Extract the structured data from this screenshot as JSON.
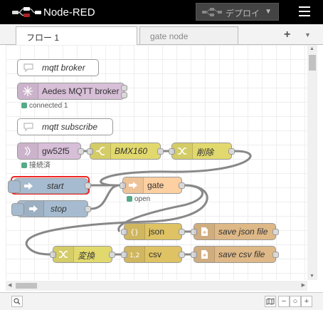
{
  "app": {
    "title": "Node-RED"
  },
  "header": {
    "deploy_label": "デプロイ"
  },
  "tabs": [
    {
      "label": "フロー 1",
      "active": true
    },
    {
      "label": "gate node",
      "active": false
    }
  ],
  "nodes": {
    "mqtt_broker": {
      "label": "mqtt broker"
    },
    "aedes": {
      "label": "Aedes MQTT broker",
      "status": "connected 1"
    },
    "mqtt_subscribe": {
      "label": "mqtt subscribe"
    },
    "gw52f5": {
      "label": "gw52f5",
      "status": "接続済"
    },
    "bmx160": {
      "label": "BMX160"
    },
    "delete": {
      "label": "削除"
    },
    "start": {
      "label": "start"
    },
    "stop": {
      "label": "stop"
    },
    "gate": {
      "label": "gate",
      "status": "open"
    },
    "json": {
      "label": "json"
    },
    "save_json": {
      "label": "save json file"
    },
    "henkan": {
      "label": "変換"
    },
    "csv": {
      "label": "csv"
    },
    "save_csv": {
      "label": "save csv file"
    }
  },
  "colors": {
    "comment": "#ffffff",
    "mqtt": "#d8bfd8",
    "function": "#e2d96e",
    "inject": "#a6bbcf",
    "gate": "#fdd0a2",
    "parser": "#dec264",
    "file": "#deb887",
    "status_ok": "#5a8",
    "selected": "#ee2222"
  },
  "icons": [
    "node-red-logo",
    "deploy-icon",
    "menu-icon",
    "comment-icon",
    "aedes-icon",
    "wireless-icon",
    "switch-icon",
    "shuffle-icon",
    "inject-arrow-icon",
    "json-icon",
    "csv-icon",
    "file-icon",
    "map-icon",
    "zoom-out-icon",
    "zoom-reset-icon",
    "zoom-in-icon",
    "search-icon"
  ]
}
